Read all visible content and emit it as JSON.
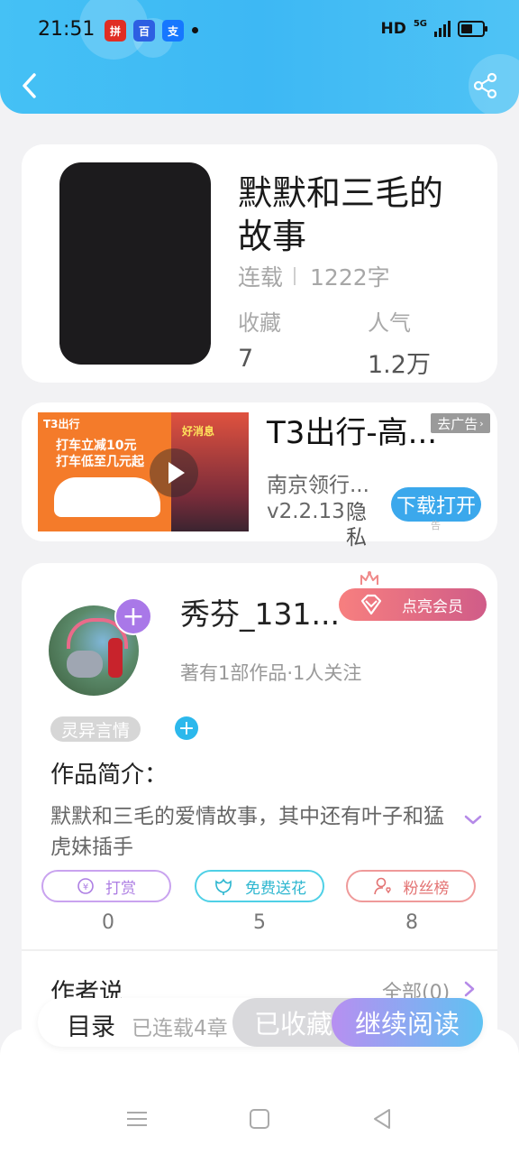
{
  "status_bar": {
    "time": "21:51",
    "apps": [
      {
        "name": "pdd-app-icon",
        "label": "拼",
        "color": "#e02e24"
      },
      {
        "name": "baidu-app-icon",
        "label": "百",
        "color": "#2d5fe2"
      },
      {
        "name": "alipay-app-icon",
        "label": "支",
        "color": "#1677ff"
      }
    ],
    "hd": "HD",
    "network": "5G"
  },
  "header": {
    "back_icon": "chevron-left-icon",
    "share_icon": "share-icon"
  },
  "book": {
    "title": "默默和三毛的故事",
    "status": "连载",
    "word_count": "1222字",
    "favorites_label": "收藏",
    "favorites_value": "7",
    "popularity_label": "人气",
    "popularity_value": "1.2万"
  },
  "ad": {
    "title": "T3出行-高...",
    "tag": "去广告",
    "company": "南京领行...",
    "version": "v2.2.13",
    "privacy": "隐私",
    "button": "下载打开",
    "small": "告",
    "image_brand": "T3出行",
    "image_line1": "打车立减10元",
    "image_line2": "打车低至几元起",
    "image_news": "好消息"
  },
  "author": {
    "name": "秀芬_131...",
    "vip_button": "点亮会员",
    "stats": "著有1部作品·1人关注",
    "genre_tag": "灵异言情",
    "intro_label": "作品简介：",
    "intro_text": "默默和三毛的爱情故事，其中还有叶子和猛虎妹插手"
  },
  "actions": [
    {
      "label": "打赏",
      "icon": "yuan-coin-icon",
      "count": "0"
    },
    {
      "label": "免费送花",
      "icon": "flower-icon",
      "count": "5"
    },
    {
      "label": "粉丝榜",
      "icon": "fan-user-icon",
      "count": "8"
    }
  ],
  "author_say": {
    "label": "作者说",
    "view_all": "全部(0)"
  },
  "bottom_bar": {
    "toc_label": "目录",
    "toc_status": "已连载4章",
    "collected_button": "已收藏",
    "read_button": "继续阅读"
  },
  "colors": {
    "header_blue": "#3db8f4",
    "accent_purple": "#a978e8",
    "vip_pink": "#e86e86"
  }
}
